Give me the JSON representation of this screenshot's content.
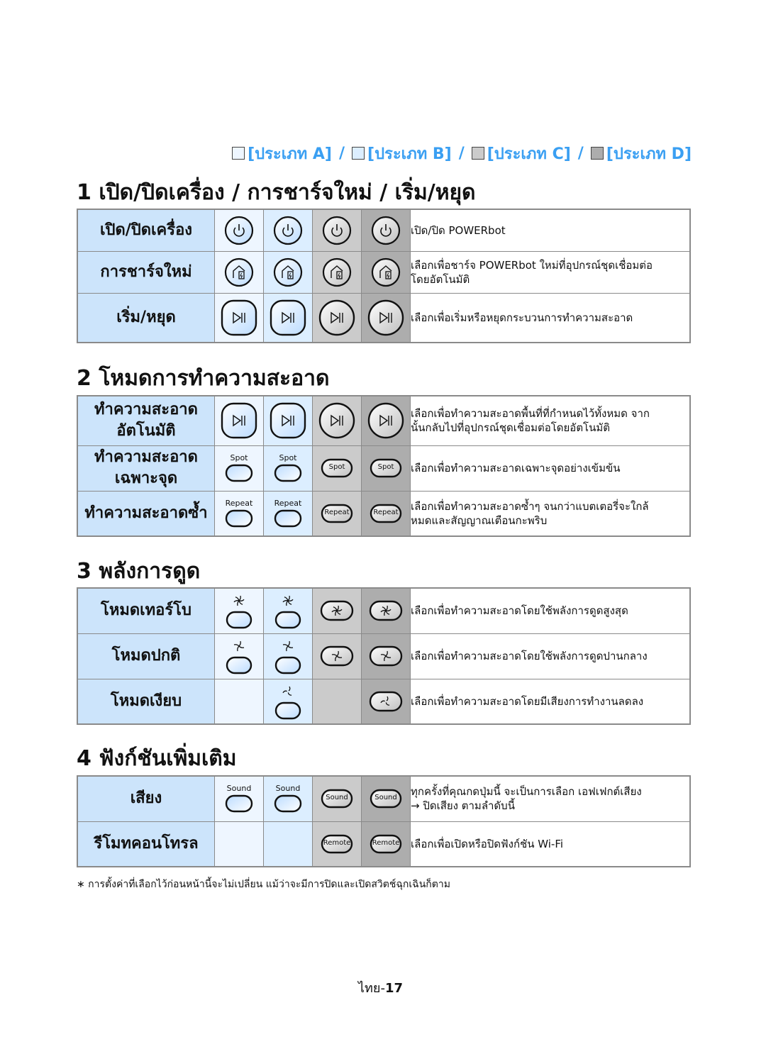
{
  "legend": {
    "types": [
      {
        "label": "[ประเภท A]",
        "color": "#eef6ff"
      },
      {
        "label": "[ประเภท B]",
        "color": "#dceeff"
      },
      {
        "label": "[ประเภท C]",
        "color": "#cbcbcb"
      },
      {
        "label": "[ประเภท D]",
        "color": "#adadad"
      }
    ],
    "separator": "/",
    "accent_color": "#3a9ff2"
  },
  "sections": [
    {
      "title": "1 เปิด/ปิดเครื่อง / การชาร์จใหม่ / เริ่ม/หยุด",
      "rows": [
        {
          "label": "เปิด/ปิดเครื่อง",
          "icon": "power-icon",
          "desc": "เปิด/ปิด POWERbot"
        },
        {
          "label": "การชาร์จใหม่",
          "icon": "home-charge-icon",
          "desc": "เลือกเพื่อชาร์จ POWERbot ใหม่ที่อุปกรณ์ชุดเชื่อมต่อ\nโดยอัตโนมัติ"
        },
        {
          "label": "เริ่ม/หยุด",
          "icon": "play-pause-icon",
          "desc": "เลือกเพื่อเริ่มหรือหยุดกระบวนการทำความสะอาด"
        }
      ]
    },
    {
      "title": "2 โหมดการทำความสะอาด",
      "rows": [
        {
          "label": "ทำความสะอาด\nอัตโนมัติ",
          "icon": "play-pause-icon",
          "desc": "เลือกเพื่อทำความสะอาดพื้นที่ที่กำหนดไว้ทั้งหมด จาก\nนั้นกลับไปที่อุปกรณ์ชุดเชื่อมต่อโดยอัตโนมัติ"
        },
        {
          "label": "ทำความสะอาด\nเฉพาะจุด",
          "button_text": "Spot",
          "desc": "เลือกเพื่อทำความสะอาดเฉพาะจุดอย่างเข้มข้น"
        },
        {
          "label": "ทำความสะอาดซ้ำ",
          "button_text": "Repeat",
          "desc": "เลือกเพื่อทำความสะอาดซ้ำๆ จนกว่าแบตเตอรี่จะใกล้\nหมดและสัญญาณเตือนกะพริบ"
        }
      ]
    },
    {
      "title": "3 พลังการดูด",
      "rows": [
        {
          "label": "โหมดเทอร์โบ",
          "icon": "fan-turbo-icon",
          "desc": "เลือกเพื่อทำความสะอาดโดยใช้พลังการดูดสูงสุด"
        },
        {
          "label": "โหมดปกติ",
          "icon": "fan-normal-icon",
          "desc": "เลือกเพื่อทำความสะอาดโดยใช้พลังการดูดปานกลาง"
        },
        {
          "label": "โหมดเงียบ",
          "icon": "fan-quiet-icon",
          "desc": "เลือกเพื่อทำความสะอาดโดยมีเสียงการทำงานลดลง"
        }
      ]
    },
    {
      "title": "4 ฟังก์ชันเพิ่มเติม",
      "rows": [
        {
          "label": "เสียง",
          "button_text": "Sound",
          "desc": "ทุกครั้งที่คุณกดปุ่มนี้ จะเป็นการเลือก เอฟเฟกต์เสียง\n→ ปิดเสียง ตามลำดับนี้"
        },
        {
          "label": "รีโมทคอนโทรล",
          "button_text": "Remote",
          "desc": "เลือกเพื่อเปิดหรือปิดฟังก์ชัน Wi-Fi"
        }
      ]
    }
  ],
  "note": "∗ การตั้งค่าที่เลือกไว้ก่อนหน้านี้จะไม่เปลี่ยน แม้ว่าจะมีการปิดและเปิดสวิตช์ฉุกเฉินก็ตาม",
  "page_number": {
    "prefix": "ไทย-",
    "number": "17"
  }
}
